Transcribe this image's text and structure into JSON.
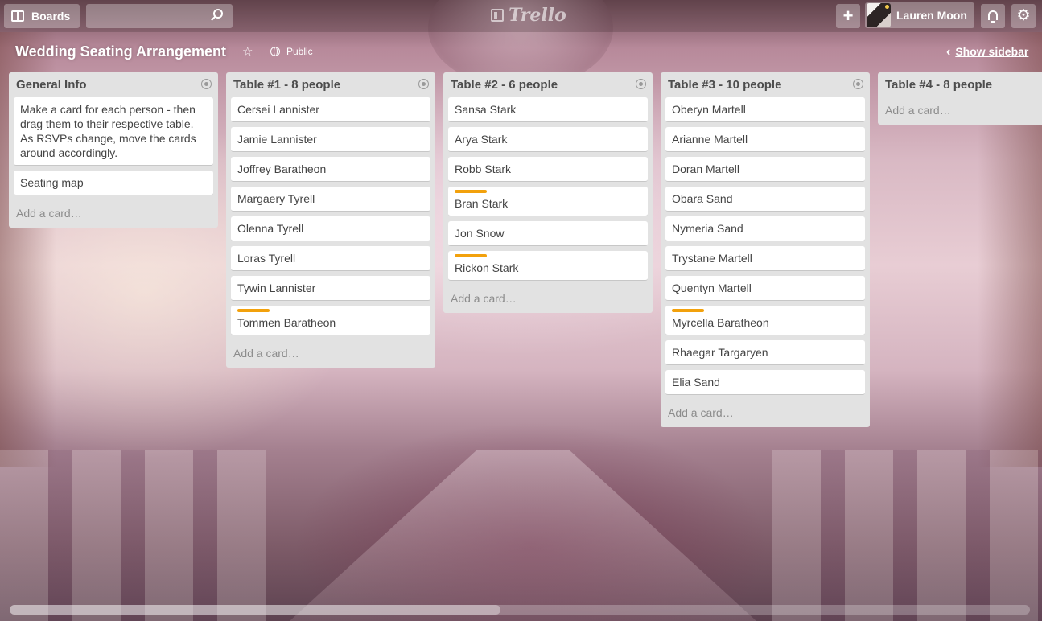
{
  "header": {
    "boards_label": "Boards",
    "search_value": "",
    "logo_text": "Trello",
    "user_name": "Lauren Moon",
    "add_label": "+",
    "settings_label": "⚙"
  },
  "board": {
    "title": "Wedding Seating Arrangement",
    "visibility": "Public",
    "show_sidebar": "Show sidebar"
  },
  "lists": [
    {
      "title": "General Info",
      "cards": [
        {
          "text": "Make a card for each person - then drag them to their respective table. As RSVPs change, move the cards around accordingly.",
          "label": false
        },
        {
          "text": "Seating map",
          "label": false
        }
      ],
      "add_card": "Add a card…"
    },
    {
      "title": "Table #1 - 8 people",
      "cards": [
        {
          "text": "Cersei Lannister",
          "label": false
        },
        {
          "text": "Jamie Lannister",
          "label": false
        },
        {
          "text": "Joffrey Baratheon",
          "label": false
        },
        {
          "text": "Margaery Tyrell",
          "label": false
        },
        {
          "text": "Olenna Tyrell",
          "label": false
        },
        {
          "text": "Loras Tyrell",
          "label": false
        },
        {
          "text": "Tywin Lannister",
          "label": false
        },
        {
          "text": "Tommen Baratheon",
          "label": true
        }
      ],
      "add_card": "Add a card…"
    },
    {
      "title": "Table #2 - 6 people",
      "cards": [
        {
          "text": "Sansa Stark",
          "label": false
        },
        {
          "text": "Arya Stark",
          "label": false
        },
        {
          "text": "Robb Stark",
          "label": false
        },
        {
          "text": "Bran Stark",
          "label": true
        },
        {
          "text": "Jon Snow",
          "label": false
        },
        {
          "text": "Rickon Stark",
          "label": true
        }
      ],
      "add_card": "Add a card…"
    },
    {
      "title": "Table #3 - 10 people",
      "cards": [
        {
          "text": "Oberyn Martell",
          "label": false
        },
        {
          "text": "Arianne Martell",
          "label": false
        },
        {
          "text": "Doran Martell",
          "label": false
        },
        {
          "text": "Obara Sand",
          "label": false
        },
        {
          "text": "Nymeria Sand",
          "label": false
        },
        {
          "text": "Trystane Martell",
          "label": false
        },
        {
          "text": "Quentyn Martell",
          "label": false
        },
        {
          "text": "Myrcella Baratheon",
          "label": true
        },
        {
          "text": "Rhaegar Targaryen",
          "label": false
        },
        {
          "text": "Elia Sand",
          "label": false
        }
      ],
      "add_card": "Add a card…"
    },
    {
      "title": "Table #4 - 8 people",
      "cards": [],
      "add_card": "Add a card…"
    }
  ],
  "colors": {
    "label_orange": "#f2a10c",
    "list_bg": "#e2e2e2"
  }
}
